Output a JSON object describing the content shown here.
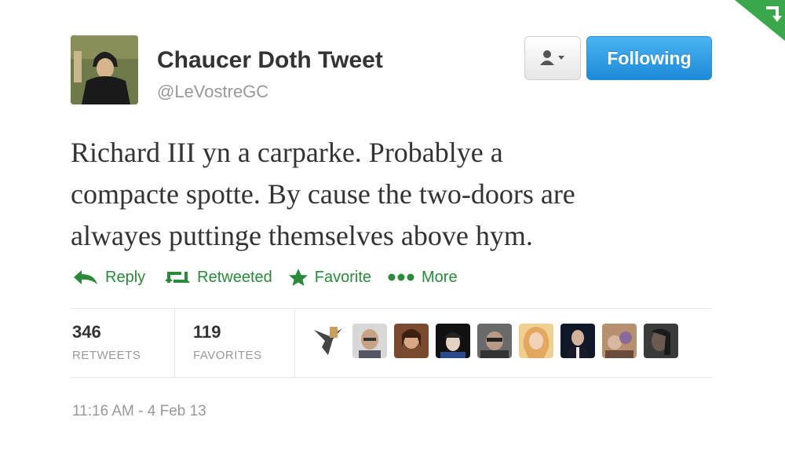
{
  "author": {
    "display_name": "Chaucer Doth Tweet",
    "screen_name": "@LeVostreGC"
  },
  "buttons": {
    "follow_label": "Following"
  },
  "tweet": {
    "lines": [
      "Richard III yn a carparke. Probablye a",
      "compacte spotte. By cause the two-doors are",
      "alwayes puttinge themselves above hym."
    ]
  },
  "actions": {
    "reply": "Reply",
    "retweet": "Retweeted",
    "favorite": "Favorite",
    "more": "More"
  },
  "stats": {
    "retweets_count": "346",
    "retweets_label": "RETWEETS",
    "favorites_count": "119",
    "favorites_label": "FAVORITES"
  },
  "timestamp": "11:16 AM - 4 Feb 13",
  "colors": {
    "action_green": "#2a8a3a",
    "follow_blue": "#1d8ad8"
  }
}
